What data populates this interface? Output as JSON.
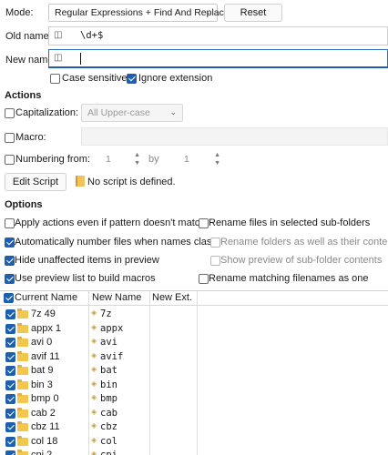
{
  "mode": {
    "label": "Mode:",
    "selected": "Regular Expressions + Find And Replace",
    "reset_label": "Reset"
  },
  "old_name": {
    "label": "Old name:",
    "value": "\\d+$"
  },
  "new_name": {
    "label": "New name:",
    "value": ""
  },
  "flags": {
    "case_sensitive": {
      "label": "Case sensitive",
      "checked": false
    },
    "ignore_extension": {
      "label": "Ignore extension",
      "checked": true
    }
  },
  "actions": {
    "title": "Actions",
    "capitalization": {
      "label": "Capitalization:",
      "checked": false,
      "selected": "All Upper-case"
    },
    "macro": {
      "label": "Macro:",
      "checked": false
    },
    "numbering": {
      "label": "Numbering from:",
      "checked": false,
      "from": "1",
      "by_label": "by",
      "by": "1"
    },
    "edit_script_label": "Edit Script",
    "script_status": "No script is defined."
  },
  "options": {
    "title": "Options",
    "apply_actions": {
      "label": "Apply actions even if pattern doesn't match",
      "checked": false
    },
    "auto_number": {
      "label": "Automatically number files when names clash",
      "checked": true
    },
    "hide_unaffected": {
      "label": "Hide unaffected items in preview",
      "checked": true
    },
    "use_preview_list": {
      "label": "Use preview list to build macros",
      "checked": true
    },
    "rename_subfolders": {
      "label": "Rename files in selected sub-folders",
      "checked": false
    },
    "rename_folders_as_well": {
      "label": "Rename folders as well as their contents",
      "checked": false,
      "disabled": true
    },
    "show_preview_subfolder": {
      "label": "Show preview of sub-folder contents",
      "checked": false,
      "disabled": true
    },
    "rename_matching": {
      "label": "Rename matching filenames as one",
      "checked": false
    }
  },
  "table": {
    "columns": [
      "Current Name",
      "New Name",
      "New Ext."
    ],
    "rows": [
      {
        "current": "7z 49",
        "new": "7z"
      },
      {
        "current": "appx 1",
        "new": "appx"
      },
      {
        "current": "avi 0",
        "new": "avi"
      },
      {
        "current": "avif 11",
        "new": "avif"
      },
      {
        "current": "bat 9",
        "new": "bat"
      },
      {
        "current": "bin 3",
        "new": "bin"
      },
      {
        "current": "bmp 0",
        "new": "bmp"
      },
      {
        "current": "cab 2",
        "new": "cab"
      },
      {
        "current": "cbz 11",
        "new": "cbz"
      },
      {
        "current": "col 18",
        "new": "col"
      },
      {
        "current": "cpi 2",
        "new": "cpi"
      }
    ]
  },
  "colors": {
    "accent": "#1f5fb0",
    "folder": "#f3c74d"
  },
  "icons": {
    "name_field": "rename-field-icon",
    "script": "script-icon",
    "folder": "folder-icon"
  }
}
